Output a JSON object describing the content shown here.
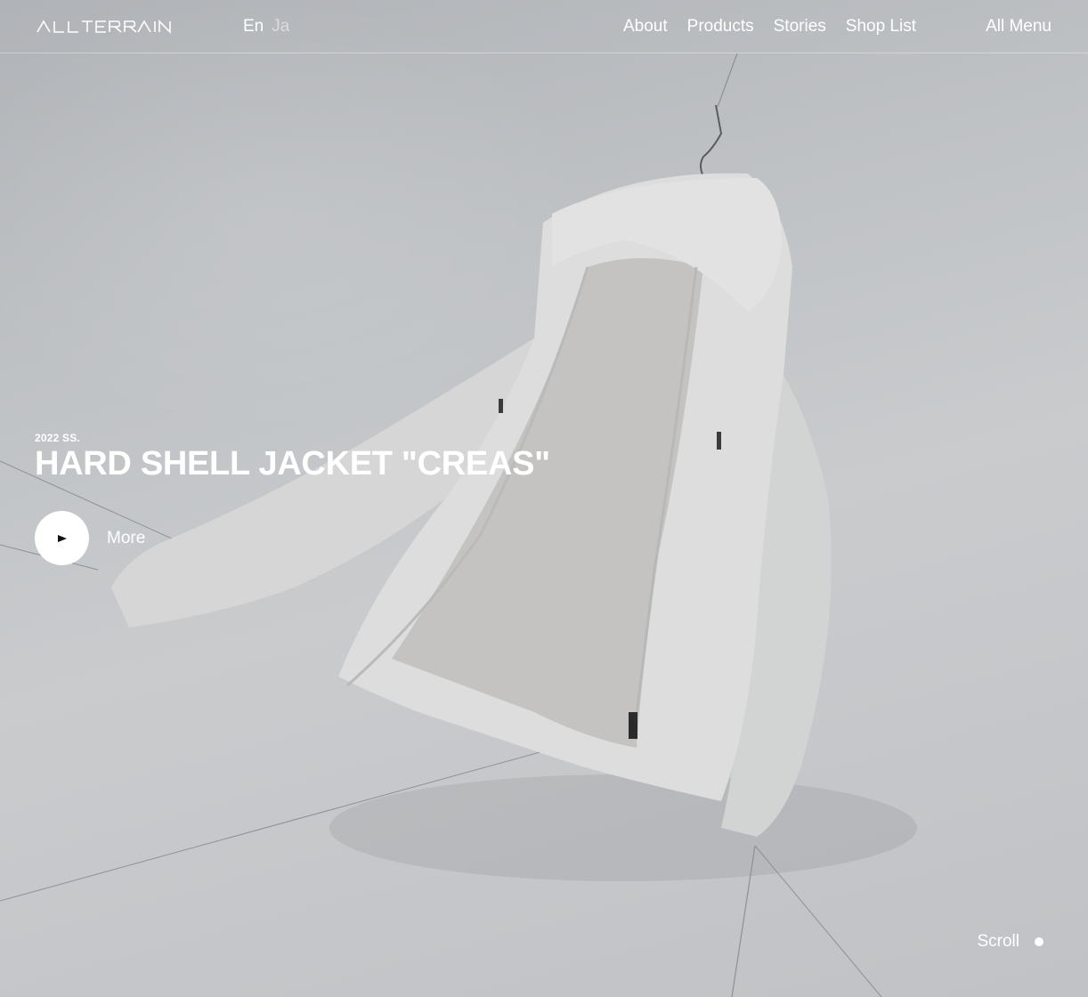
{
  "brand": {
    "logo_text": "ALLTERRAIN"
  },
  "language": {
    "options": [
      "En",
      "Ja"
    ],
    "selected": "En"
  },
  "nav": {
    "items": [
      "About",
      "Products",
      "Stories",
      "Shop List"
    ]
  },
  "menu": {
    "label": "All Menu"
  },
  "hero": {
    "season": "2022 SS.",
    "title": "HARD SHELL JACKET \"CREAS\"",
    "more_label": "More",
    "background_image": "hanging-light-grey-hard-shell-jacket-photo"
  },
  "scroll": {
    "label": "Scroll"
  },
  "colors": {
    "text": "#ffffff",
    "background": "#c3c5c8",
    "jacket": "#d9dad9"
  }
}
